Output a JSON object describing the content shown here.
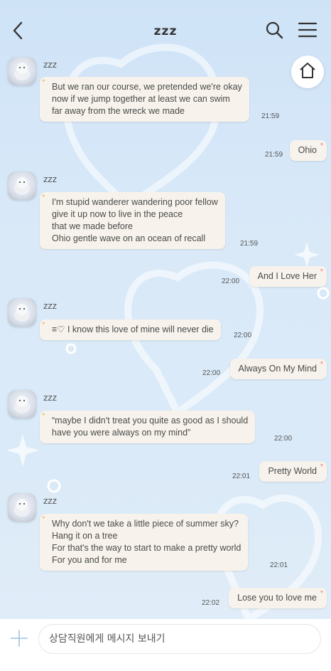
{
  "header": {
    "title": "zzz"
  },
  "messages": [
    {
      "type": "in",
      "sender": "zzz",
      "text": "But we ran our course, we pretended we're okay\nnow if we jump together at least we can swim\nfar away from the wreck we made",
      "time": "21:59"
    },
    {
      "type": "out",
      "text": "Ohio",
      "time": "21:59"
    },
    {
      "type": "in",
      "sender": "zzz",
      "text": "I'm stupid wanderer wandering poor fellow\ngive it up now to live in the peace\nthat we made before\nOhio gentle wave on an ocean of recall",
      "time": "21:59"
    },
    {
      "type": "out",
      "text": "And I Love Her",
      "time": "22:00"
    },
    {
      "type": "in",
      "sender": "zzz",
      "text": "≡♡ I know this love of mine will never die",
      "time": "22:00"
    },
    {
      "type": "out",
      "text": "Always On My Mind",
      "time": "22:00"
    },
    {
      "type": "in",
      "sender": "zzz",
      "text": "“maybe I didn't treat you quite as good as I should\nhave you were always on my mind”",
      "time": "22:00"
    },
    {
      "type": "out",
      "text": "Pretty World",
      "time": "22:01"
    },
    {
      "type": "in",
      "sender": "zzz",
      "text": "Why don't we take a little piece of summer sky?\nHang it on a tree\nFor that's the way to start to make a pretty world\nFor you and for me",
      "time": "22:01"
    },
    {
      "type": "out",
      "text": "Lose you to love me",
      "time": "22:02"
    }
  ],
  "composer": {
    "placeholder": "상담직원에게 메시지 보내기"
  },
  "icons": {
    "back": "chevron-left-icon",
    "search": "search-icon",
    "menu": "hamburger-menu-icon",
    "home": "home-icon",
    "plus": "plus-icon"
  }
}
